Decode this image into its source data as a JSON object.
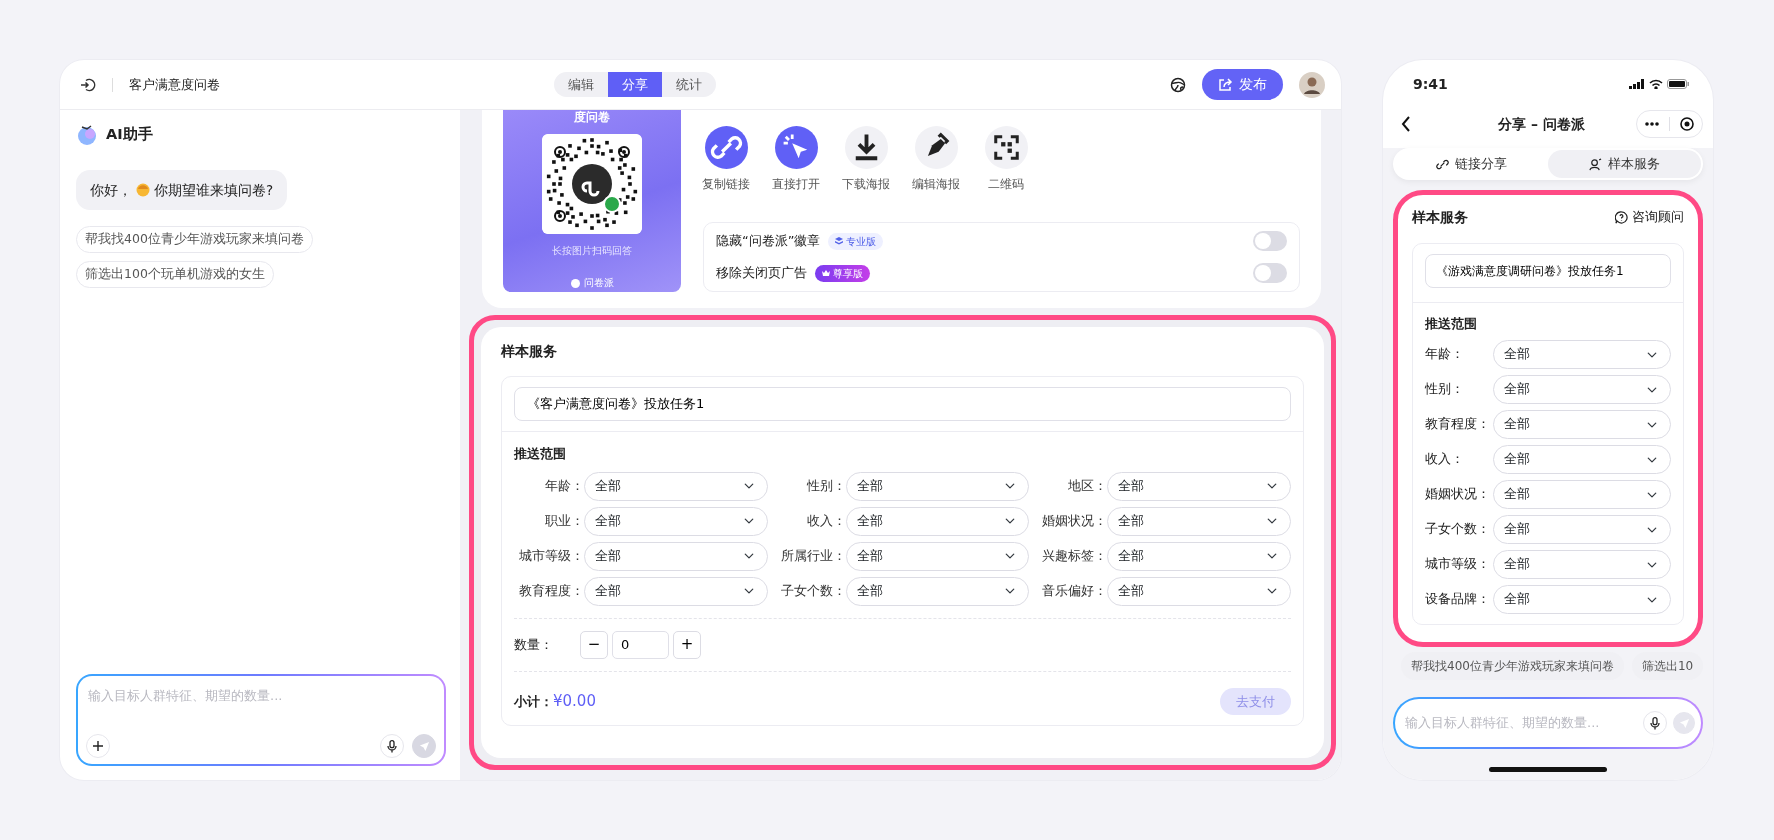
{
  "header": {
    "title": "客户满意度问卷",
    "publish": "发布",
    "tabs": [
      {
        "label": "编辑",
        "selected": false
      },
      {
        "label": "分享",
        "selected": true
      },
      {
        "label": "统计",
        "selected": false
      }
    ]
  },
  "assistant": {
    "title": "AI助手",
    "greeting_start": "你好，",
    "greeting_end": "你期望谁来填问卷?",
    "suggestions": [
      "帮我找400位青少年游戏玩家来填问卷",
      "筛选出100个玩单机游戏的女生"
    ],
    "input": {
      "placeholder": "输入目标人群特征、期望的数量..."
    }
  },
  "share": {
    "poster": {
      "title": "度问卷",
      "hint": "长按图片扫码回答",
      "brand": "问卷派"
    },
    "actions": [
      {
        "label": "复制链接",
        "kind": "link",
        "highlighted": true
      },
      {
        "label": "直接打开",
        "kind": "open",
        "highlighted": true
      },
      {
        "label": "下载海报",
        "kind": "download",
        "highlighted": false
      },
      {
        "label": "编辑海报",
        "kind": "edit",
        "highlighted": false
      },
      {
        "label": "二维码",
        "kind": "qr",
        "highlighted": false
      }
    ],
    "options": [
      {
        "label": "隐藏“问卷派”徽章",
        "badge": "专业版",
        "kind": "pro",
        "on": false
      },
      {
        "label": "移除关闭页广告",
        "badge": "尊享版",
        "kind": "premium",
        "on": false
      }
    ]
  },
  "sample_service": {
    "title": "样本服务",
    "task_name": "《客户满意度问卷》投放任务1",
    "section": "推送范围",
    "filters": [
      {
        "label": "年龄：",
        "value": "全部"
      },
      {
        "label": "性别：",
        "value": "全部"
      },
      {
        "label": "地区：",
        "value": "全部"
      },
      {
        "label": "职业：",
        "value": "全部"
      },
      {
        "label": "收入：",
        "value": "全部"
      },
      {
        "label": "婚姻状况：",
        "value": "全部"
      },
      {
        "label": "城市等级：",
        "value": "全部"
      },
      {
        "label": "所属行业：",
        "value": "全部"
      },
      {
        "label": "兴趣标签：",
        "value": "全部"
      },
      {
        "label": "教育程度：",
        "value": "全部"
      },
      {
        "label": "子女个数：",
        "value": "全部"
      },
      {
        "label": "音乐偏好：",
        "value": "全部"
      }
    ],
    "quantity": {
      "label": "数量：",
      "value": "0",
      "minus": "−",
      "plus": "+"
    },
    "subtotal": {
      "label": "小计：",
      "amount": "¥0.00"
    },
    "pay_button": {
      "label": "去支付",
      "disabled": true
    }
  },
  "phone": {
    "time": "9:41",
    "title": "分享 – 问卷派",
    "tabs": [
      {
        "label": "链接分享",
        "kind": "link",
        "selected": false
      },
      {
        "label": "样本服务",
        "kind": "person",
        "selected": true
      }
    ],
    "panel_title": "样本服务",
    "consult": "咨询顾问",
    "task_name": "《游戏满意度调研问卷》投放任务1",
    "section": "推送范围",
    "filters": [
      {
        "label": "年龄：",
        "value": "全部"
      },
      {
        "label": "性别：",
        "value": "全部"
      },
      {
        "label": "教育程度：",
        "value": "全部"
      },
      {
        "label": "收入：",
        "value": "全部"
      },
      {
        "label": "婚姻状况：",
        "value": "全部"
      },
      {
        "label": "子女个数：",
        "value": "全部"
      },
      {
        "label": "城市等级：",
        "value": "全部"
      },
      {
        "label": "设备品牌：",
        "value": "全部"
      }
    ],
    "suggestions": [
      "帮我找400位青少年游戏玩家来填问卷",
      "筛选出10"
    ],
    "input": {
      "placeholder": "输入目标人群特征、期望的数量..."
    }
  }
}
